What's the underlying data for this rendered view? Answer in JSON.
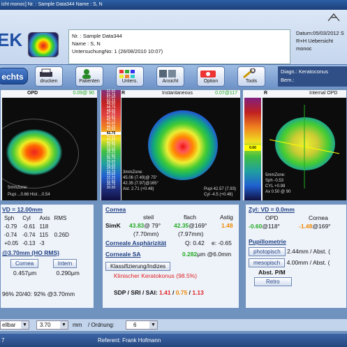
{
  "window": {
    "title": "icht monoc]  Nr. : Sample Data344  Name : S,  N"
  },
  "header": {
    "logo_text": "EK",
    "patient": {
      "nr": "Nr. : Sample Data344",
      "name": "Name : S,  N",
      "exam": "UntersuchungNo: 1 (26/08/2010 10:07)"
    },
    "date": "Datum:05/03/2012 S",
    "view_mode": "R+H Uebersicht monoc"
  },
  "toolbar": {
    "left_label": "echts",
    "buttons": [
      {
        "label": "drucken",
        "icon": "printer-icon"
      },
      {
        "label": "Patienten",
        "icon": "patients-icon"
      },
      {
        "label": "Unters.",
        "icon": "exams-icon"
      },
      {
        "label": "Ansicht",
        "icon": "view-icon"
      },
      {
        "label": "Option",
        "icon": "options-icon"
      },
      {
        "label": "Tools",
        "icon": "tools-icon"
      }
    ],
    "diag_label": "Diagn.: Keratoconus",
    "bem_label": "Bem.:"
  },
  "maps": {
    "left": {
      "title": "OPD",
      "value": "0.09@ 90",
      "foot": "Pupi ...0.66  Hist ...0.54",
      "zone": "5mmZone:"
    },
    "center": {
      "eye": "R",
      "title": "Instantaneous",
      "value": "0.07@117",
      "cursor": "42.75",
      "foot1": "3mmZone:",
      "foot2": "45.06 (7.49)@ 75°",
      "foot3": "42.35 (7.97)@165°",
      "foot4": "Ast. 2.71 (+0.48)",
      "pupil": "Pupi 42.57 (7.93)",
      "cyl": "Cyl -4.5 (+0.48)"
    },
    "right": {
      "eye": "R",
      "title": "Internal OPD",
      "value": "0.07@117",
      "cursor": "0.00",
      "zone": "5mmZone:",
      "sph": "Sph -0.53",
      "cyl": "CYL +0.98",
      "ax": "Ax 0.50 @ 90"
    }
  },
  "scale_values": [
    "52.50",
    "51.75",
    "51.00",
    "50.25",
    "49.50",
    "48.75",
    "48.00",
    "47.25",
    "46.50",
    "45.75",
    "45.00",
    "44.25",
    "43.50",
    "42.75",
    "42.00",
    "41.25",
    "40.50",
    "39.75",
    "39.00",
    "38.25",
    "37.50",
    "36.75",
    "36.00",
    "35.25",
    "34.50",
    "33.75",
    "33.00",
    "32.25",
    "31.50",
    "30.75",
    "30.00"
  ],
  "left_panel": {
    "vd": "VD = 12.00mm",
    "headers": [
      "Sph",
      "Cyl",
      "Axis",
      "RMS"
    ],
    "rows": [
      [
        "-0.79",
        "-0.61",
        "118",
        ""
      ],
      [
        "-0.74",
        "-0.74",
        "115",
        "0.26D"
      ],
      [
        "+0.05",
        "-0.13",
        "-3",
        ""
      ]
    ],
    "ho_title": "@3.70mm (HO RMS)",
    "cornea_label": "Cornea",
    "intern_label": "Intern",
    "cornea_val": "0.457μm",
    "intern_val": "0.290μm",
    "acuity": "96%  20/40: 92%  @3.70mm"
  },
  "center_panel": {
    "cornea_title": "Cornea",
    "col_steil": "steil",
    "col_flach": "flach",
    "col_astig": "Astig",
    "simk_label": "SimK",
    "simk_steil": "43.83",
    "simk_steil_ax": "@ 79°",
    "simk_flach": "42.35",
    "simk_flach_ax": "@169°",
    "simk_astig": "1.48",
    "radius_steil": "(7.70mm)",
    "radius_flach": "(7.97mm)",
    "asph_title": "Corneale Asphärizität",
    "asph_q": "Q: 0.42",
    "asph_e": "e: -0.65",
    "sa_title": "Corneale SA",
    "sa_value": "0.282",
    "sa_unit": "μm @6.0mm",
    "klass_button": "Klassifizierung/Indizes",
    "klass_result": "Klinischer Keratokonus (98.5%)",
    "sdp_label": "SDP / SRI / SAI:",
    "sdp": "1.41",
    "sri": "0.75",
    "sai": "1.13"
  },
  "right_panel": {
    "zyl": "Zyl: VD = 0.0mm",
    "col_opd": "OPD",
    "col_cornea": "Cornea",
    "opd_val": "-0.60",
    "opd_ax": "@118°",
    "cornea_val": "-1.48",
    "cornea_ax": "@169°",
    "pupil_title": "Pupillometrie",
    "photopic_btn": "photopisch",
    "photopic_val": "2.44mm / Abst. (",
    "mesopic_btn": "mesopisch",
    "mesopic_val": "4.00mm / Abst. (",
    "abst_label": "Abst. P/M",
    "retro_btn": "Retro"
  },
  "bottom": {
    "select1": "ellbar",
    "value": "3.70",
    "unit": "mm",
    "ordnung_label": "/ Ordnung:",
    "ordnung": "6"
  },
  "status": {
    "left": "7",
    "referent": "Referent: Frank Hofmann"
  }
}
